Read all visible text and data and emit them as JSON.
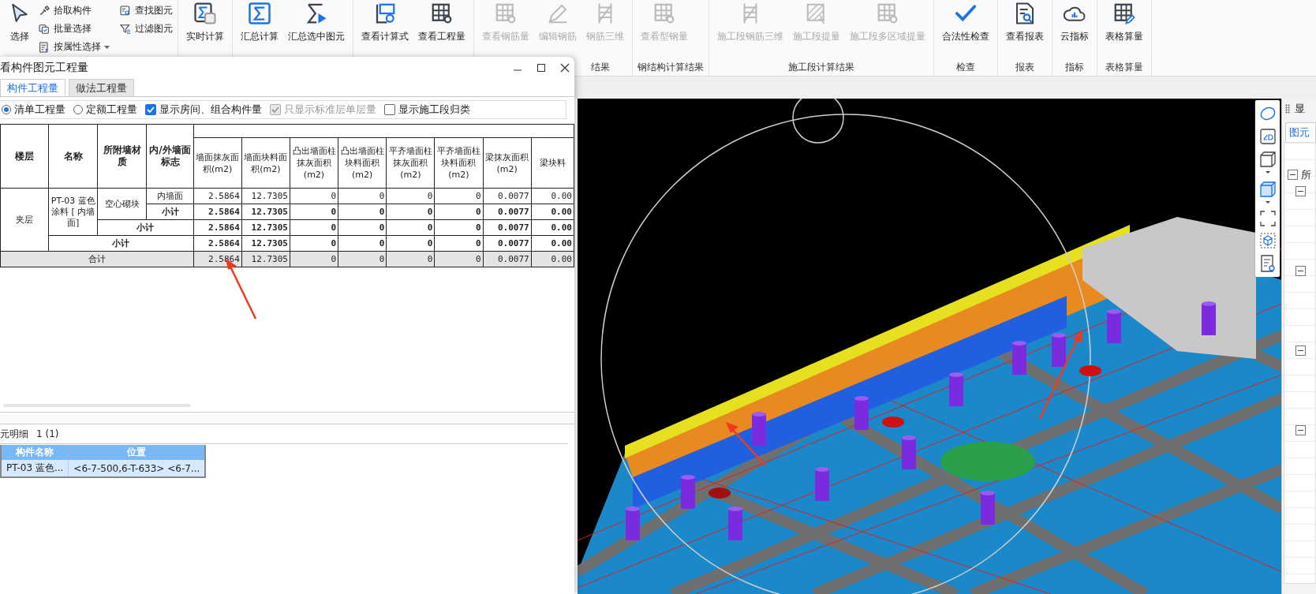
{
  "toolbar": {
    "groups": [
      {
        "items": [
          {
            "kind": "large",
            "label": "选择",
            "disabled": false
          },
          {
            "kind": "small",
            "label": "拾取构件",
            "disabled": false
          },
          {
            "kind": "small",
            "label": "批量选择",
            "disabled": false
          },
          {
            "kind": "dropdown",
            "label": "按属性选择",
            "disabled": false
          },
          {
            "kind": "small",
            "label": "查找图元",
            "disabled": false
          },
          {
            "kind": "small",
            "label": "过滤图元",
            "disabled": false
          }
        ]
      },
      {
        "items": [
          {
            "kind": "large",
            "label": "实时计算",
            "disabled": false
          }
        ]
      },
      {
        "items": [
          {
            "kind": "large",
            "label": "汇总计算",
            "disabled": false
          },
          {
            "kind": "large",
            "label": "汇总选中图元",
            "disabled": false
          }
        ]
      },
      {
        "items": [
          {
            "kind": "large",
            "label": "查看计算式",
            "disabled": false
          },
          {
            "kind": "large",
            "label": "查看工程量",
            "disabled": false
          }
        ]
      },
      {
        "label": "结果",
        "items": [
          {
            "kind": "large",
            "label": "查看钢筋量",
            "disabled": true
          },
          {
            "kind": "large",
            "label": "编辑钢筋",
            "disabled": true
          },
          {
            "kind": "large",
            "label": "钢筋三维",
            "disabled": true
          }
        ]
      },
      {
        "label": "钢结构计算结果",
        "items": [
          {
            "kind": "large",
            "label": "查看型钢量",
            "disabled": true
          }
        ]
      },
      {
        "label": "施工段计算结果",
        "items": [
          {
            "kind": "large",
            "label": "施工段钢筋三维",
            "disabled": true
          },
          {
            "kind": "large",
            "label": "施工段提量",
            "disabled": true
          },
          {
            "kind": "large",
            "label": "施工段多区域提量",
            "disabled": true
          }
        ]
      },
      {
        "label": "检查",
        "items": [
          {
            "kind": "large",
            "label": "合法性检查",
            "disabled": false
          }
        ]
      },
      {
        "label": "报表",
        "items": [
          {
            "kind": "large",
            "label": "查看报表",
            "disabled": false
          }
        ]
      },
      {
        "label": "指标",
        "items": [
          {
            "kind": "large",
            "label": "云指标",
            "disabled": false
          }
        ]
      },
      {
        "label": "表格算量",
        "items": [
          {
            "kind": "large",
            "label": "表格算量",
            "disabled": false
          }
        ]
      }
    ]
  },
  "dialog": {
    "title": "看构件图元工程量",
    "tabs": [
      {
        "label": "构件工程量",
        "selected": true
      },
      {
        "label": "做法工程量",
        "selected": false
      }
    ],
    "options": [
      {
        "kind": "radio",
        "label": "清单工程量",
        "checked": true,
        "disabled": false
      },
      {
        "kind": "radio",
        "label": "定额工程量",
        "checked": false,
        "disabled": false
      },
      {
        "kind": "checkbox",
        "label": "显示房间、组合构件量",
        "checked": true,
        "disabled": false
      },
      {
        "kind": "checkbox",
        "label": "只显示标准层单层量",
        "checked": true,
        "disabled": true
      },
      {
        "kind": "checkbox",
        "label": "显示施工段归类",
        "checked": false,
        "disabled": false
      }
    ],
    "table": {
      "columns": [
        "楼层",
        "名称",
        "所附墙材质",
        "内/外墙面标志",
        "墙面抹灰面积(m2)",
        "墙面块料面积(m2)",
        "凸出墙面柱抹灰面积(m2)",
        "凸出墙面柱块料面积(m2)",
        "平齐墙面柱抹灰面积(m2)",
        "平齐墙面柱块料面积(m2)",
        "梁抹灰面积(m2)",
        "梁块料"
      ],
      "rows": [
        {
          "kind": "item",
          "floor": "夹层",
          "name": "PT-03 蓝色涂料 [ 内墙面]",
          "material": "空心砌块",
          "side": "内墙面",
          "values": [
            "2.5864",
            "12.7305",
            "0",
            "0",
            "0",
            "0",
            "0.0077",
            "0.00"
          ]
        },
        {
          "kind": "subtotal_side",
          "label": "小计",
          "values": [
            "2.5864",
            "12.7305",
            "0",
            "0",
            "0",
            "0",
            "0.0077",
            "0.00"
          ]
        },
        {
          "kind": "subtotal_material",
          "label": "小计",
          "values": [
            "2.5864",
            "12.7305",
            "0",
            "0",
            "0",
            "0",
            "0.0077",
            "0.00"
          ]
        },
        {
          "kind": "subtotal_name",
          "label": "小计",
          "values": [
            "2.5864",
            "12.7305",
            "0",
            "0",
            "0",
            "0",
            "0.0077",
            "0.00"
          ]
        },
        {
          "kind": "total",
          "label": "合计",
          "values": [
            "2.5864",
            "12.7305",
            "0",
            "0",
            "0",
            "0",
            "0.0077",
            "0.00"
          ]
        }
      ]
    },
    "detail": {
      "title": "元明细",
      "count": "1 (1)",
      "columns": [
        "构件名称",
        "位置"
      ],
      "rows": [
        {
          "cells": [
            "PT-03 蓝色...",
            "<6-7-500,6-T-633> <6-7..."
          ],
          "selected": true
        }
      ]
    }
  },
  "side_panel": {
    "title": "显",
    "tab": "图元",
    "tree": [
      {
        "label": "所",
        "expanded": true,
        "children": [
          {
            "expanded": true
          },
          {
            "expanded": true
          },
          {
            "expanded": true
          },
          {
            "expanded": true
          }
        ]
      }
    ]
  }
}
